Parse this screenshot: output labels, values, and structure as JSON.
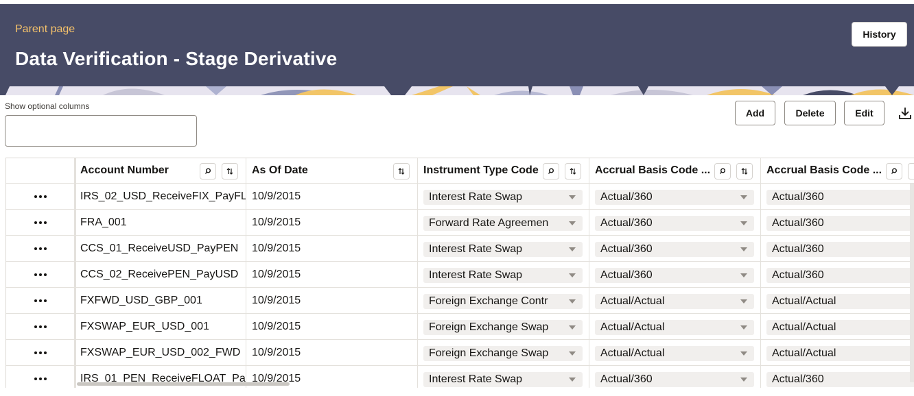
{
  "header": {
    "parent_link": "Parent page",
    "title": "Data Verification - Stage Derivative",
    "history_label": "History"
  },
  "toolbar": {
    "optional_columns_label": "Show optional columns",
    "optional_columns_value": "",
    "add_label": "Add",
    "delete_label": "Delete",
    "edit_label": "Edit",
    "download_icon": "download-icon"
  },
  "table": {
    "columns": [
      {
        "label": "Account Number"
      },
      {
        "label": "As Of Date"
      },
      {
        "label": "Instrument Type Code"
      },
      {
        "label": "Accrual Basis Code ..."
      },
      {
        "label": "Accrual Basis Code ..."
      }
    ],
    "rows": [
      {
        "account": "IRS_02_USD_ReceiveFIX_PayFL",
        "date": "10/9/2015",
        "instrument": "Interest Rate Swap",
        "accrual1": "Actual/360",
        "accrual2": "Actual/360"
      },
      {
        "account": "FRA_001",
        "date": "10/9/2015",
        "instrument": "Forward Rate Agreemen",
        "accrual1": "Actual/360",
        "accrual2": "Actual/360"
      },
      {
        "account": "CCS_01_ReceiveUSD_PayPEN",
        "date": "10/9/2015",
        "instrument": "Interest Rate Swap",
        "accrual1": "Actual/360",
        "accrual2": "Actual/360"
      },
      {
        "account": "CCS_02_ReceivePEN_PayUSD",
        "date": "10/9/2015",
        "instrument": "Interest Rate Swap",
        "accrual1": "Actual/360",
        "accrual2": "Actual/360"
      },
      {
        "account": "FXFWD_USD_GBP_001",
        "date": "10/9/2015",
        "instrument": "Foreign Exchange Contr",
        "accrual1": "Actual/Actual",
        "accrual2": "Actual/Actual"
      },
      {
        "account": "FXSWAP_EUR_USD_001",
        "date": "10/9/2015",
        "instrument": "Foreign Exchange Swap",
        "accrual1": "Actual/Actual",
        "accrual2": "Actual/Actual"
      },
      {
        "account": "FXSWAP_EUR_USD_002_FWD",
        "date": "10/9/2015",
        "instrument": "Foreign Exchange Swap",
        "accrual1": "Actual/Actual",
        "accrual2": "Actual/Actual"
      },
      {
        "account": "IRS_01_PEN_ReceiveFLOAT_Pa",
        "date": "10/9/2015",
        "instrument": "Interest Rate Swap",
        "accrual1": "Actual/360",
        "accrual2": "Actual/360"
      }
    ]
  },
  "colors": {
    "header_bg": "#474b66",
    "parent_link": "#f5c26b",
    "title": "#ffffff"
  }
}
